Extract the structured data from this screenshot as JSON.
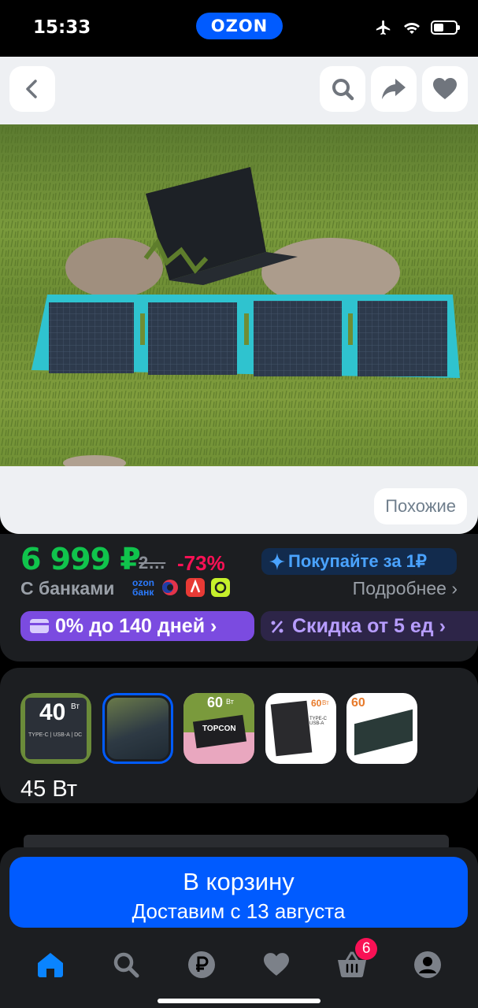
{
  "status_bar": {
    "time": "15:33",
    "app_logo": "OZON"
  },
  "product": {
    "similar_label": "Похожие",
    "price": "6 999 ₽",
    "old_price": "2…",
    "discount": "-73%",
    "buy_for": "Покупайте за 1₽",
    "banks_label": "С банками",
    "ozon_bank_line1": "ozon",
    "ozon_bank_line2": "банк",
    "more_link": "Подробнее ›",
    "installment_chip": "0% до 140 дней ›",
    "bulk_discount_chip": "Скидка от 5 ед ›"
  },
  "variants": {
    "thumbs": [
      {
        "label": "40",
        "unit": "Вт",
        "caption": "TYPE-C | USB-A | DC"
      },
      {
        "label": "",
        "unit": "",
        "caption": ""
      },
      {
        "label": "60",
        "unit": "Вт",
        "caption": "TOPCON"
      },
      {
        "label": "60",
        "unit": "Вт",
        "caption": "TYPE-C USB-A"
      },
      {
        "label": "60",
        "unit": "",
        "caption": ""
      }
    ],
    "selected_label": "45 Вт"
  },
  "cart": {
    "title": "В корзину",
    "subtitle": "Доставим с 13 августа"
  },
  "tabbar": {
    "cart_badge": "6"
  },
  "colors": {
    "accent": "#005bff",
    "price": "#10c44c",
    "discount": "#f91155",
    "purple": "#7b4be0"
  }
}
